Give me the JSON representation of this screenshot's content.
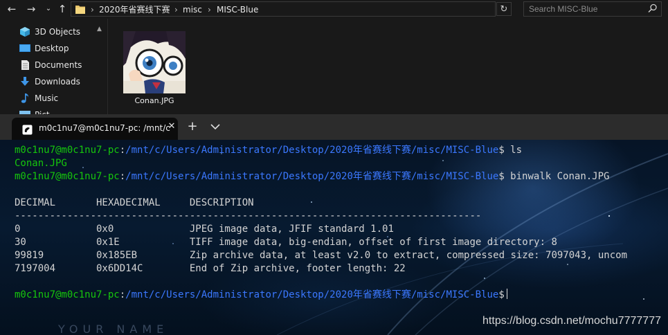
{
  "explorer": {
    "address_segments": [
      "2020年省赛线下赛",
      "misc",
      "MISC-Blue"
    ],
    "search_placeholder": "Search MISC-Blue",
    "nav_items": [
      {
        "label": "3D Objects",
        "icon": "3d-objects-icon"
      },
      {
        "label": "Desktop",
        "icon": "desktop-icon"
      },
      {
        "label": "Documents",
        "icon": "documents-icon"
      },
      {
        "label": "Downloads",
        "icon": "downloads-icon"
      },
      {
        "label": "Music",
        "icon": "music-icon"
      },
      {
        "label": "Pict",
        "icon": "pictures-icon"
      }
    ],
    "files": [
      {
        "name": "Conan.JPG",
        "icon": "jpg-thumbnail"
      }
    ]
  },
  "terminal": {
    "tab_title": "m0c1nu7@m0c1nu7-pc: /mnt/c",
    "lines": [
      {
        "prompt_user": "m0c1nu7@m0c1nu7-pc",
        "prompt_colon": ":",
        "prompt_path": "/mnt/c/Users/Administrator/Desktop/2020年省赛线下赛/misc/MISC-Blue",
        "prompt_sym": "$",
        "command": " ls"
      },
      {
        "output": "Conan.JPG"
      },
      {
        "prompt_user": "m0c1nu7@m0c1nu7-pc",
        "prompt_colon": ":",
        "prompt_path": "/mnt/c/Users/Administrator/Desktop/2020年省赛线下赛/misc/MISC-Blue",
        "prompt_sym": "$",
        "command": " binwalk Conan.JPG"
      },
      {
        "output": "DECIMAL       HEXADECIMAL     DESCRIPTION"
      },
      {
        "output": "--------------------------------------------------------------------------------"
      },
      {
        "output": "0             0x0             JPEG image data, JFIF standard 1.01"
      },
      {
        "output": "30            0x1E            TIFF image data, big-endian, offset of first image directory: 8"
      },
      {
        "output": "99819         0x185EB         Zip archive data, at least v2.0 to extract, compressed size: 7097043, uncom"
      },
      {
        "output": "7197004       0x6DD14C        End of Zip archive, footer length: 22"
      },
      {
        "prompt_user": "m0c1nu7@m0c1nu7-pc",
        "prompt_colon": ":",
        "prompt_path": "/mnt/c/Users/Administrator/Desktop/2020年省赛线下赛/misc/MISC-Blue",
        "prompt_sym": "$",
        "command": ""
      }
    ],
    "background_text": "YOUR NAME",
    "watermark": "https://blog.csdn.net/mochu7777777"
  },
  "colors": {
    "prompt_green": "#16c60c",
    "prompt_blue": "#3b78ff",
    "terminal_text": "#d4d4d4",
    "explorer_bg": "#191919"
  }
}
